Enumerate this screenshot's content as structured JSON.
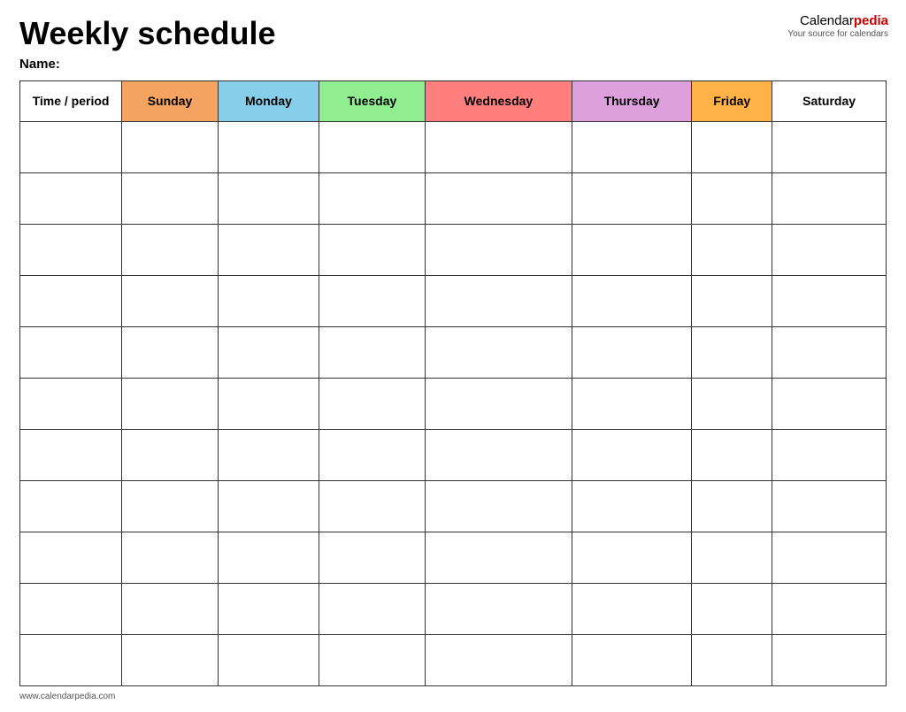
{
  "page": {
    "title": "Weekly schedule",
    "name_label": "Name:",
    "brand": {
      "calendar": "Calendar",
      "pedia": "pedia",
      "tagline": "Your source for calendars"
    },
    "footer": "www.calendarpedia.com"
  },
  "table": {
    "headers": [
      {
        "key": "time",
        "label": "Time / period",
        "color": "#ffffff"
      },
      {
        "key": "sunday",
        "label": "Sunday",
        "color": "#f4a460"
      },
      {
        "key": "monday",
        "label": "Monday",
        "color": "#87ceeb"
      },
      {
        "key": "tuesday",
        "label": "Tuesday",
        "color": "#90ee90"
      },
      {
        "key": "wednesday",
        "label": "Wednesday",
        "color": "#ff7f7f"
      },
      {
        "key": "thursday",
        "label": "Thursday",
        "color": "#dda0dd"
      },
      {
        "key": "friday",
        "label": "Friday",
        "color": "#ffb347"
      },
      {
        "key": "saturday",
        "label": "Saturday",
        "color": "#ffffff"
      }
    ],
    "row_count": 11
  }
}
